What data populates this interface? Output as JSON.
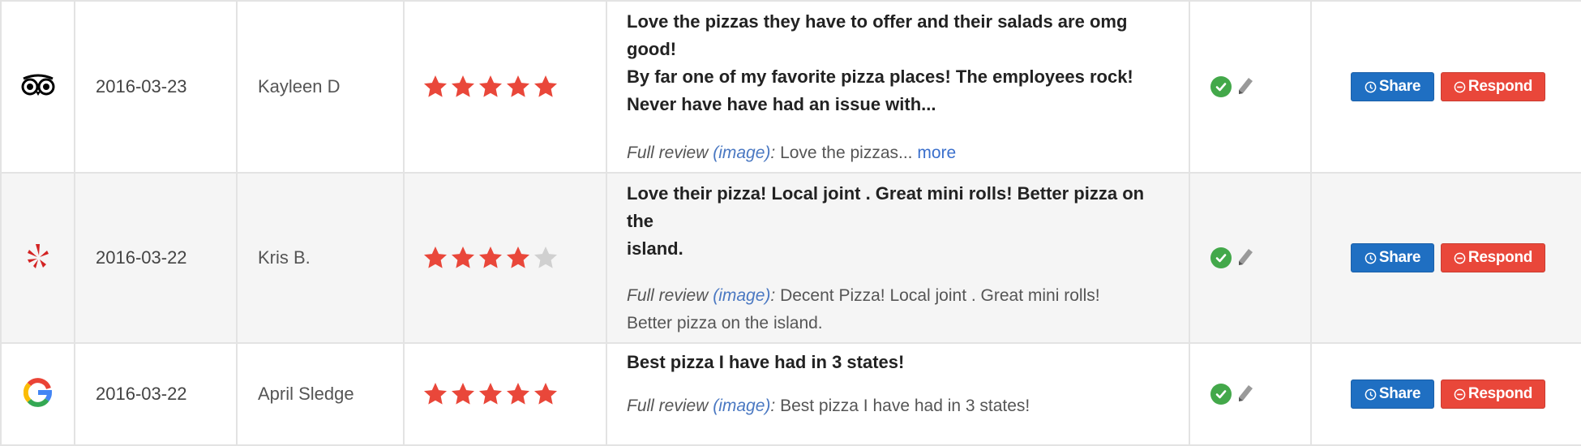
{
  "colors": {
    "star_filled": "#E9473A",
    "star_empty": "#D0D0D0",
    "check": "#43A84A",
    "share": "#1F6FC2",
    "respond": "#E9473A"
  },
  "reviews": [
    {
      "source_icon": "tripadvisor-icon",
      "date": "2016-03-23",
      "reviewer": "Kayleen D",
      "rating": 5,
      "summary_lines": [
        "Love the pizzas they have to offer and their salads are omg good!",
        "By far one of my favorite pizza places! The employees rock!",
        "Never have have had an issue with..."
      ],
      "full_review_label": "Full review",
      "image_link": "(image)",
      "separator": ":",
      "full_review_lines": [
        "Love the pizzas..."
      ],
      "more_link": "more",
      "share_label": "Share",
      "respond_label": "Respond"
    },
    {
      "source_icon": "yelp-icon",
      "date": "2016-03-22",
      "reviewer": "Kris B.",
      "rating": 4,
      "summary_lines": [
        "Love their pizza! Local joint . Great mini rolls! Better pizza on the",
        "island."
      ],
      "full_review_label": "Full review",
      "image_link": "(image)",
      "separator": ":",
      "full_review_lines": [
        "Decent Pizza! Local joint . Great mini rolls!",
        "Better pizza on the island."
      ],
      "share_label": "Share",
      "respond_label": "Respond"
    },
    {
      "source_icon": "google-icon",
      "date": "2016-03-22",
      "reviewer": "April Sledge",
      "rating": 5,
      "summary_lines": [
        "Best pizza I have had in 3 states!"
      ],
      "full_review_label": "Full review",
      "image_link": "(image)",
      "separator": ":",
      "full_review_lines": [
        "Best pizza I have had in 3 states!"
      ],
      "share_label": "Share",
      "respond_label": "Respond"
    }
  ]
}
